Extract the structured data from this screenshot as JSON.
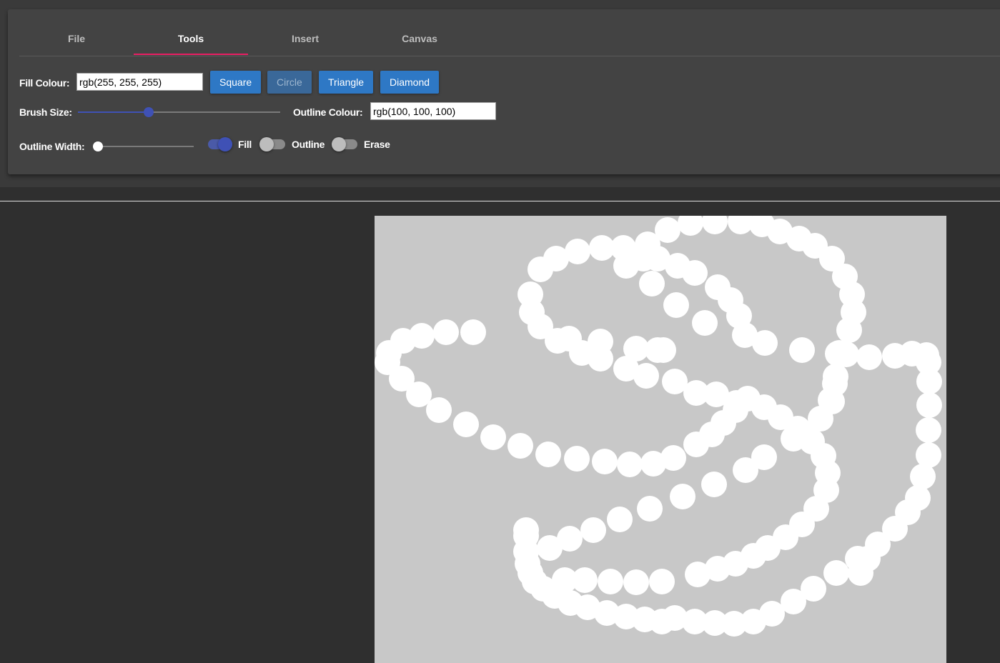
{
  "tabs": [
    "File",
    "Tools",
    "Insert",
    "Canvas"
  ],
  "active_tab": "Tools",
  "tools": {
    "fill_colour_label": "Fill Colour:",
    "fill_colour_value": "rgb(255, 255, 255)",
    "shape_buttons": [
      "Square",
      "Circle",
      "Triangle",
      "Diamond"
    ],
    "disabled_shape": "Circle",
    "brush_size_label": "Brush Size:",
    "brush_size_level": 0.35,
    "outline_colour_label": "Outline Colour:",
    "outline_colour_value": "rgb(100, 100, 100)",
    "outline_width_label": "Outline Width:",
    "outline_width_level": 0.0,
    "toggles": [
      {
        "label": "Fill",
        "on": true
      },
      {
        "label": "Outline",
        "on": false
      },
      {
        "label": "Erase",
        "on": false
      }
    ]
  },
  "colors": {
    "accent_tab": "#e91e63",
    "slider_accent": "#3f51b5",
    "button": "#2e78c5",
    "canvas_bg": "#c8c8c8",
    "stroke": "#ffffff"
  }
}
